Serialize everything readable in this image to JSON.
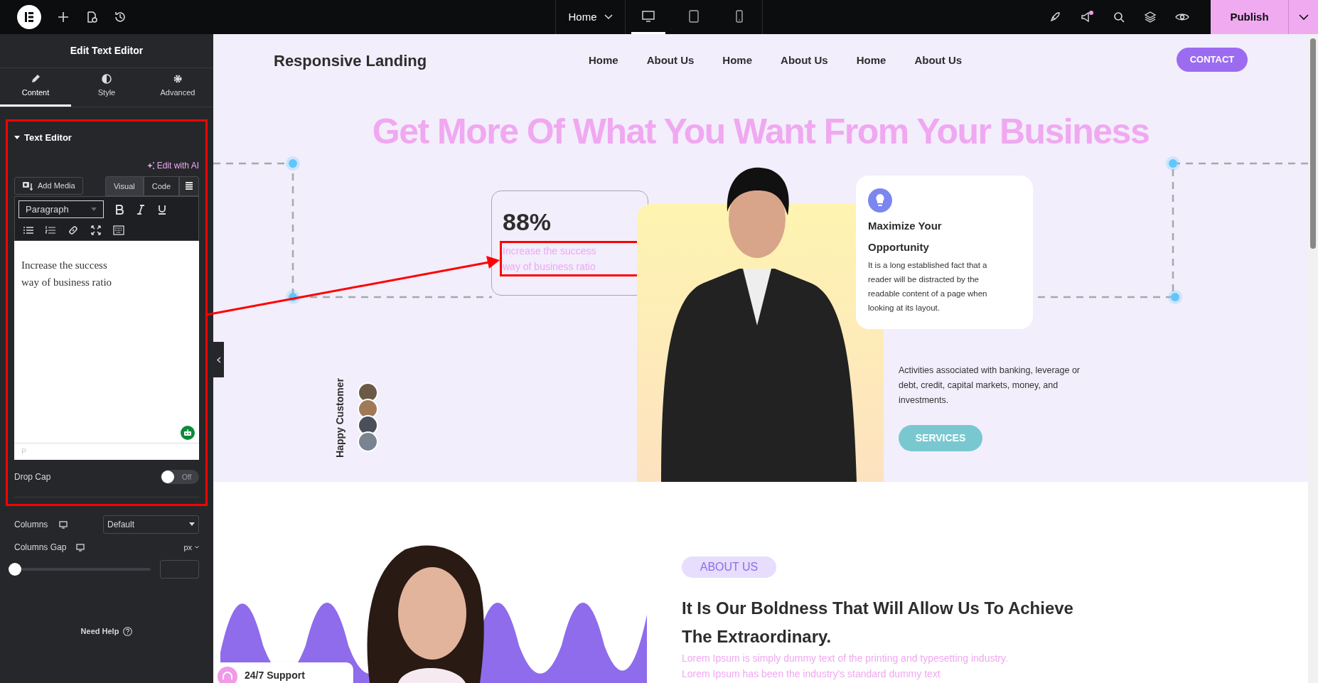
{
  "topbar": {
    "page_menu": "Home",
    "publish": "Publish",
    "devices": [
      {
        "kind": "desktop",
        "selected": true
      },
      {
        "kind": "tablet",
        "selected": false
      },
      {
        "kind": "mobile",
        "selected": false
      }
    ]
  },
  "panel": {
    "title": "Edit Text Editor",
    "tabs": [
      {
        "kind": "content",
        "label": "Content",
        "selected": true
      },
      {
        "kind": "style",
        "label": "Style",
        "selected": false
      },
      {
        "kind": "advanced",
        "label": "Advanced",
        "selected": false
      }
    ],
    "section": {
      "title": "Text Editor",
      "expanded": true
    },
    "edit_with_ai": "Edit with AI",
    "add_media": "Add Media",
    "editor_tabs": [
      {
        "label": "Visual",
        "selected": true
      },
      {
        "label": "Code",
        "selected": false
      }
    ],
    "format": "Paragraph",
    "editor_lines": [
      "Increase the success",
      "way of business ratio"
    ],
    "path": "P",
    "drop_cap": {
      "label": "Drop Cap",
      "on": false,
      "state_text": "Off"
    },
    "columns": {
      "label": "Columns",
      "value": "Default"
    },
    "columns_gap": {
      "label": "Columns Gap",
      "unit": "px",
      "level": 0
    },
    "help": "Need Help"
  },
  "canvas": {
    "brand": "Responsive Landing",
    "nav": [
      "Home",
      "About Us",
      "Home",
      "About Us",
      "Home",
      "About Us"
    ],
    "contact": "CONTACT",
    "headline": "Get More Of What You Want From Your Business",
    "stat": {
      "value": "88%",
      "lines": [
        "Increase the success",
        "way of business ratio"
      ]
    },
    "feature": {
      "title": "Maximize Your Opportunity",
      "text": "It is a long established fact that a reader will be distracted by the readable content of a page when looking at its layout."
    },
    "activities": "Activities associated with banking, leverage or debt, credit, capital markets, money, and investments.",
    "services": "SERVICES",
    "happy_customer": "Happy Customer",
    "about": {
      "badge": "ABOUT US",
      "heading": "It Is Our Boldness That Will Allow Us To Achieve The Extraordinary.",
      "text": "Lorem Ipsum is simply dummy text of the printing and typesetting industry. Lorem Ipsum has been the industry's standard dummy text"
    },
    "support": "24/7 Support"
  }
}
